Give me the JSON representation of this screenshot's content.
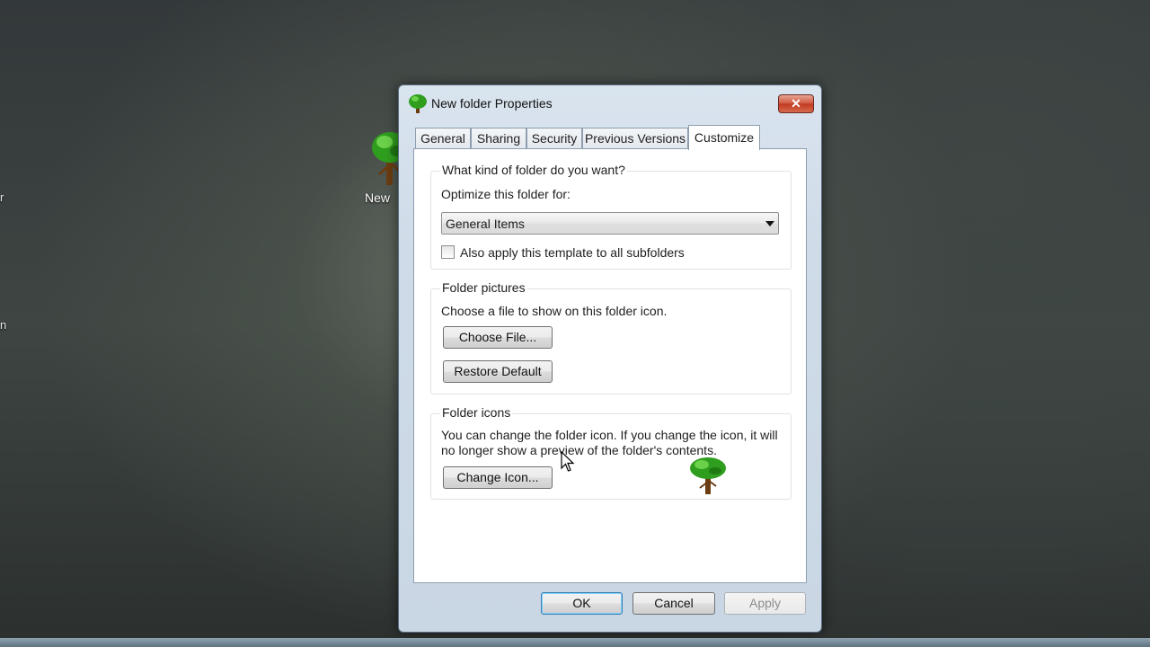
{
  "desktop": {
    "edge_labels": [
      "r",
      "n"
    ],
    "icon_label": "New"
  },
  "dialog": {
    "title": "New folder Properties",
    "close_label": "✕",
    "tabs": [
      {
        "label": "General",
        "active": false
      },
      {
        "label": "Sharing",
        "active": false
      },
      {
        "label": "Security",
        "active": false
      },
      {
        "label": "Previous Versions",
        "active": false
      },
      {
        "label": "Customize",
        "active": true
      }
    ],
    "folder_type": {
      "title": "What kind of folder do you want?",
      "optimize_label": "Optimize this folder for:",
      "selected": "General Items",
      "apply_subfolders_label": "Also apply this template to all subfolders",
      "apply_subfolders_checked": false
    },
    "folder_pictures": {
      "title": "Folder pictures",
      "description": "Choose a file to show on this folder icon.",
      "choose_file": "Choose File...",
      "restore_default": "Restore Default"
    },
    "folder_icons": {
      "title": "Folder icons",
      "description_line1": "You can change the folder icon. If you change the icon, it will",
      "description_line2": "no longer show a preview of the folder's contents.",
      "change_icon": "Change Icon...",
      "preview_icon": "tree-icon"
    },
    "buttons": {
      "ok": "OK",
      "cancel": "Cancel",
      "apply": "Apply"
    }
  },
  "colors": {
    "accent": "#3c7fb1",
    "close": "#c13a20"
  }
}
